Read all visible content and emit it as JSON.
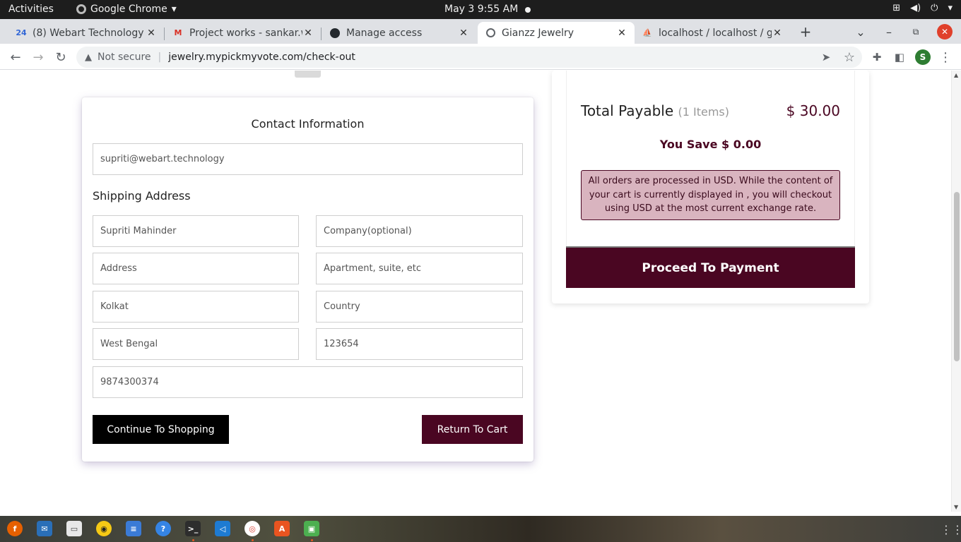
{
  "system": {
    "activities": "Activities",
    "app_name": "Google Chrome",
    "clock": "May 3   9:55 AM"
  },
  "tabs": [
    {
      "title": "(8) Webart Technology",
      "favicon": "24"
    },
    {
      "title": "Project works - sankar.w",
      "favicon": "M"
    },
    {
      "title": "Manage access",
      "favicon": "github-icon"
    },
    {
      "title": "Gianzz Jewelry",
      "favicon": "globe-icon"
    },
    {
      "title": "localhost / localhost / g",
      "favicon": "phpmyadmin-icon"
    }
  ],
  "toolbar": {
    "security": "Not secure",
    "url": "jewelry.mypickmyvote.com/check-out",
    "profile_initial": "S"
  },
  "contact": {
    "heading": "Contact Information",
    "email": "supriti@webart.technology",
    "shipping_heading": "Shipping Address",
    "name": "Supriti Mahinder",
    "company_placeholder": "Company(optional)",
    "address_placeholder": "Address",
    "apartment_placeholder": "Apartment, suite, etc",
    "city": "Kolkat",
    "country_placeholder": "Country",
    "state": "West Bengal",
    "zip": "123654",
    "phone": "9874300374",
    "continue_label": "Continue To Shopping",
    "return_label": "Return To Cart"
  },
  "summary": {
    "total_label": "Total Payable",
    "items_label": "(1 Items)",
    "total_amount": "$ 30.00",
    "saving": "You Save $ 0.00",
    "note": "All orders are processed in USD. While the content of your cart is currently displayed in , you will checkout using USD at the most current exchange rate.",
    "proceed_label": "Proceed To Payment"
  },
  "colors": {
    "brand_maroon": "#4a0622",
    "note_bg": "#d9b4bf"
  }
}
